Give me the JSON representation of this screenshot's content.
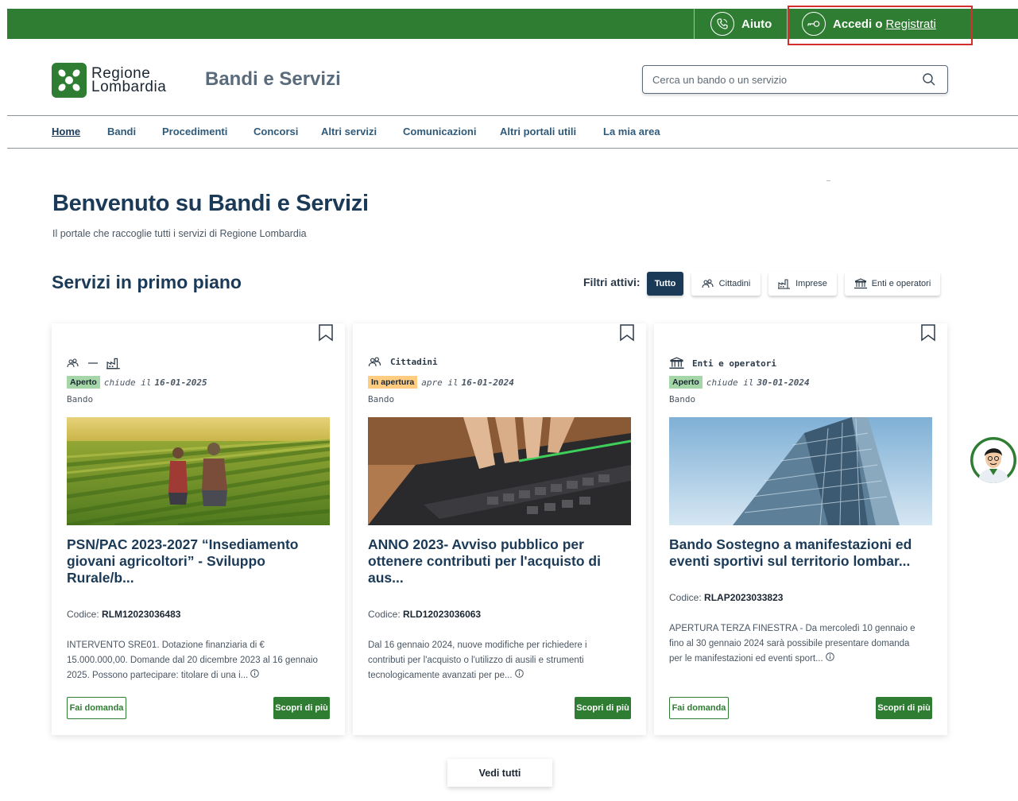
{
  "topbar": {
    "help_label": "Aiuto",
    "login_label": "Accedi o",
    "register_label": "Registrati"
  },
  "header": {
    "logo_line1": "Regione",
    "logo_line2": "Lombardia",
    "site_title": "Bandi e Servizi",
    "search_placeholder": "Cerca un bando o un servizio"
  },
  "nav": {
    "items": [
      "Home",
      "Bandi",
      "Procedimenti",
      "Concorsi",
      "Altri servizi",
      "Comunicazioni",
      "Altri portali utili",
      "La mia area"
    ]
  },
  "welcome": {
    "title": "Benvenuto su Bandi e Servizi",
    "subtitle": "Il portale che raccoglie tutti i servizi di Regione Lombardia"
  },
  "section": {
    "title": "Servizi in primo piano",
    "filters_label": "Filtri attivi:",
    "filters": [
      "Tutto",
      "Cittadini",
      "Imprese",
      "Enti e operatori"
    ]
  },
  "cards": [
    {
      "category": "",
      "status": "Aperto",
      "status_text": "chiude il",
      "date": "16-01-2025",
      "type": "Bando",
      "title": "PSN/PAC 2023-2027 “Insediamento giovani agricoltori” - Sviluppo Rurale/b...",
      "code_label": "Codice:",
      "code": "RLM12023036483",
      "description": "INTERVENTO SRE01. Dotazione finanziaria di € 15.000.000,00. Domande dal 20 dicembre 2023 al 16 gennaio 2025. Possono partecipare: titolare di una i...",
      "apply_label": "Fai domanda",
      "more_label": "Scopri di più"
    },
    {
      "category": "Cittadini",
      "status": "In apertura",
      "status_text": "apre il",
      "date": "16-01-2024",
      "type": "Bando",
      "title": "ANNO 2023- Avviso pubblico per ottenere contributi per l'acquisto di aus...",
      "code_label": "Codice:",
      "code": "RLD12023036063",
      "description": "Dal 16 gennaio 2024, nuove modifiche per richiedere i contributi per l'acquisto o l'utilizzo di ausili e strumenti tecnologicamente avanzati per pe...",
      "more_label": "Scopri di più"
    },
    {
      "category": "Enti e operatori",
      "status": "Aperto",
      "status_text": "chiude il",
      "date": "30-01-2024",
      "type": "Bando",
      "title": "Bando Sostegno a manifestazioni ed eventi sportivi sul territorio lombar...",
      "code_label": "Codice:",
      "code": "RLAP2023033823",
      "description": "APERTURA TERZA FINESTRA - Da mercoledì 10 gennaio e fino al 30 gennaio 2024 sarà possibile presentare domanda per le manifestazioni ed eventi sport...",
      "apply_label": "Fai domanda",
      "more_label": "Scopri di più"
    }
  ],
  "see_all_label": "Vedi tutti",
  "colors": {
    "brand_green": "#2e7d32",
    "navy": "#1b3a57",
    "highlight_red": "#d32f2f",
    "badge_open": "#a5d6a7",
    "badge_soon": "#ffcc80"
  }
}
